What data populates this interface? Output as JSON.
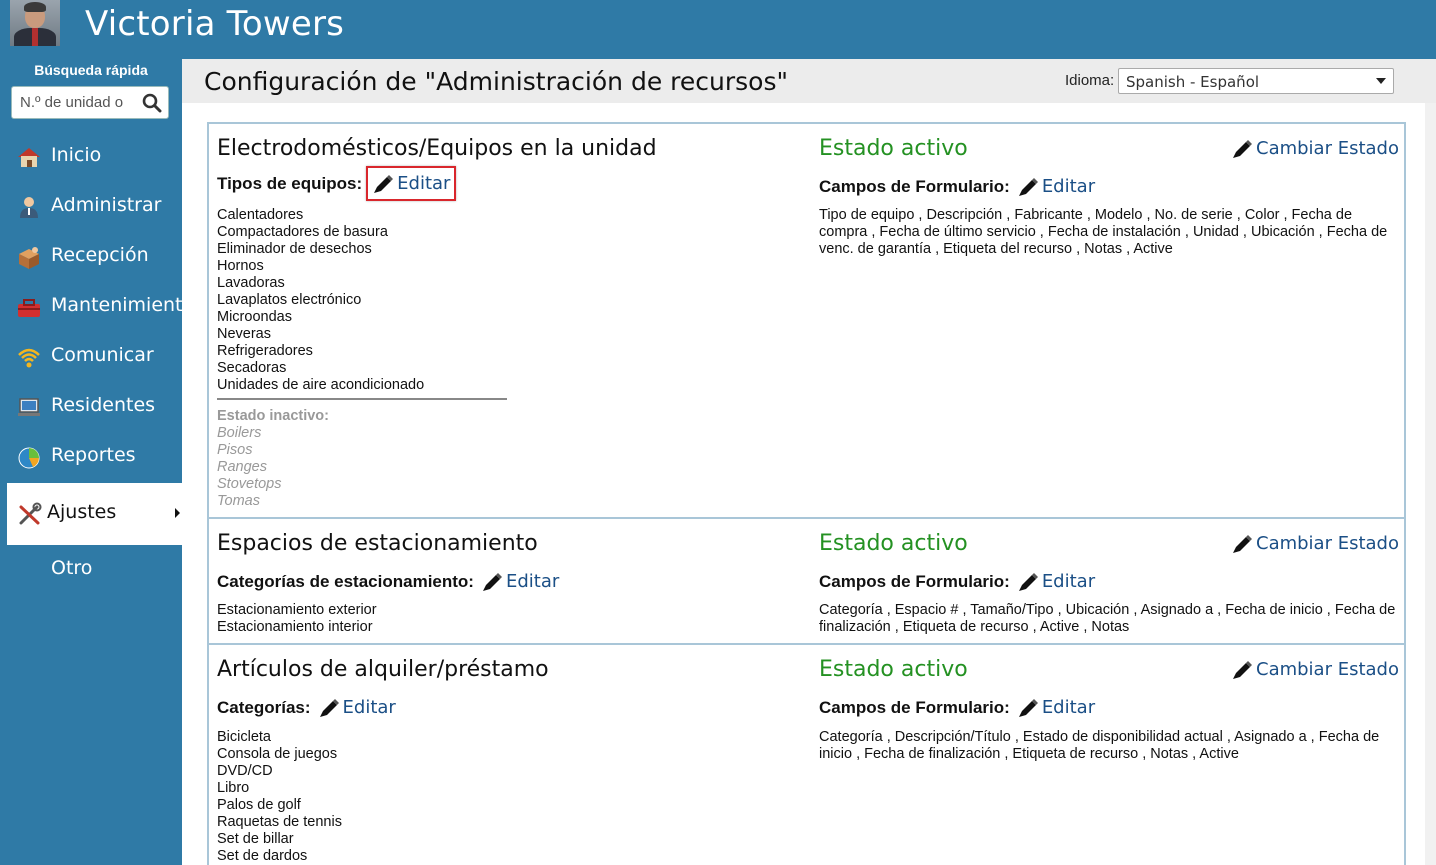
{
  "header": {
    "title": "Victoria Towers"
  },
  "sidebar": {
    "quick_search_label": "Búsqueda rápida",
    "quick_search_placeholder": "N.º de unidad o",
    "items": [
      {
        "label": "Inicio",
        "icon": "house-icon"
      },
      {
        "label": "Administrar",
        "icon": "manager-icon"
      },
      {
        "label": "Recepción",
        "icon": "package-icon"
      },
      {
        "label": "Mantenimiento",
        "icon": "toolbox-icon"
      },
      {
        "label": "Comunicar",
        "icon": "broadcast-icon"
      },
      {
        "label": "Residentes",
        "icon": "laptop-icon"
      },
      {
        "label": "Reportes",
        "icon": "pie-chart-icon"
      },
      {
        "label": "Ajustes",
        "icon": "tools-icon",
        "active": true
      },
      {
        "label": "Otro"
      }
    ]
  },
  "main": {
    "page_title": "Configuración de \"Administración de recursos\"",
    "language_label": "Idioma:",
    "language_selected": "Spanish - Español"
  },
  "sections": [
    {
      "title": "Electrodomésticos/Equipos en la unidad",
      "status": "Estado activo",
      "change_status": "Cambiar Estado",
      "left_label": "Tipos de equipos:",
      "edit": "Editar",
      "right_label": "Campos de Formulario:",
      "items": [
        "Calentadores",
        "Compactadores de basura",
        "Eliminador de desechos",
        "Hornos",
        "Lavadoras",
        "Lavaplatos electrónico",
        "Microondas",
        "Neveras",
        "Refrigeradores",
        "Secadoras",
        "Unidades de aire acondicionado"
      ],
      "inactive_label": "Estado inactivo:",
      "inactive_items": [
        "Boilers",
        "Pisos",
        "Ranges",
        "Stovetops",
        "Tomas"
      ],
      "fields": "Tipo de equipo , Descripción , Fabricante , Modelo , No. de serie , Color , Fecha de compra , Fecha de último servicio , Fecha de instalación , Unidad , Ubicación , Fecha de venc. de garantía , Etiqueta del recurso , Notas , Active"
    },
    {
      "title": "Espacios de estacionamiento",
      "status": "Estado activo",
      "change_status": "Cambiar Estado",
      "left_label": "Categorías de estacionamiento:",
      "edit": "Editar",
      "right_label": "Campos de Formulario:",
      "items": [
        "Estacionamiento exterior",
        "Estacionamiento interior"
      ],
      "fields": "Categoría , Espacio # , Tamaño/Tipo , Ubicación , Asignado a , Fecha de inicio , Fecha de finalización , Etiqueta de recurso , Active , Notas"
    },
    {
      "title": "Artículos de alquiler/préstamo",
      "status": "Estado activo",
      "change_status": "Cambiar Estado",
      "left_label": "Categorías:",
      "edit": "Editar",
      "right_label": "Campos de Formulario:",
      "items": [
        "Bicicleta",
        "Consola de juegos",
        "DVD/CD",
        "Libro",
        "Palos de golf",
        "Raquetas de tennis",
        "Set de billar",
        "Set de dardos"
      ],
      "fields": "Categoría , Descripción/Título , Estado de disponibilidad actual , Asignado a , Fecha de inicio , Fecha de finalización , Etiqueta de recurso , Notas , Active"
    }
  ],
  "colors": {
    "brand": "#2f7aa6",
    "active_status": "#249122",
    "link": "#1b4f86",
    "highlight": "#d9262c"
  }
}
